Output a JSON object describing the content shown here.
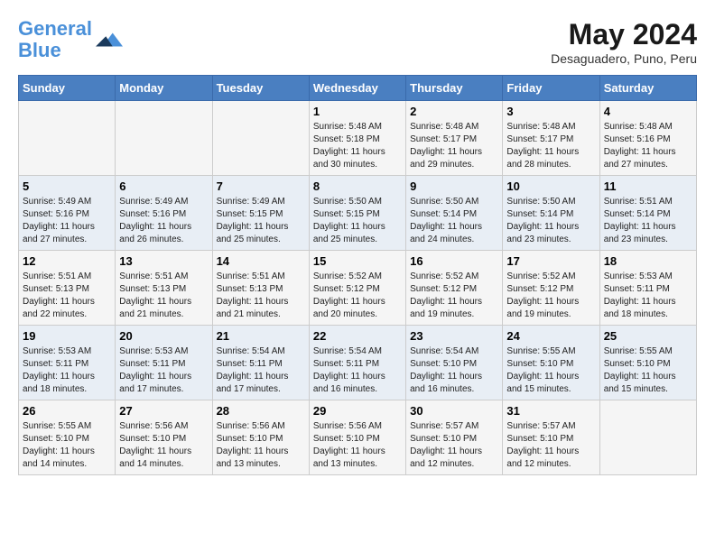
{
  "header": {
    "logo_line1": "General",
    "logo_line2": "Blue",
    "main_title": "May 2024",
    "subtitle": "Desaguadero, Puno, Peru"
  },
  "calendar": {
    "days_of_week": [
      "Sunday",
      "Monday",
      "Tuesday",
      "Wednesday",
      "Thursday",
      "Friday",
      "Saturday"
    ],
    "weeks": [
      [
        {
          "day": "",
          "info": ""
        },
        {
          "day": "",
          "info": ""
        },
        {
          "day": "",
          "info": ""
        },
        {
          "day": "1",
          "info": "Sunrise: 5:48 AM\nSunset: 5:18 PM\nDaylight: 11 hours and 30 minutes."
        },
        {
          "day": "2",
          "info": "Sunrise: 5:48 AM\nSunset: 5:17 PM\nDaylight: 11 hours and 29 minutes."
        },
        {
          "day": "3",
          "info": "Sunrise: 5:48 AM\nSunset: 5:17 PM\nDaylight: 11 hours and 28 minutes."
        },
        {
          "day": "4",
          "info": "Sunrise: 5:48 AM\nSunset: 5:16 PM\nDaylight: 11 hours and 27 minutes."
        }
      ],
      [
        {
          "day": "5",
          "info": "Sunrise: 5:49 AM\nSunset: 5:16 PM\nDaylight: 11 hours and 27 minutes."
        },
        {
          "day": "6",
          "info": "Sunrise: 5:49 AM\nSunset: 5:16 PM\nDaylight: 11 hours and 26 minutes."
        },
        {
          "day": "7",
          "info": "Sunrise: 5:49 AM\nSunset: 5:15 PM\nDaylight: 11 hours and 25 minutes."
        },
        {
          "day": "8",
          "info": "Sunrise: 5:50 AM\nSunset: 5:15 PM\nDaylight: 11 hours and 25 minutes."
        },
        {
          "day": "9",
          "info": "Sunrise: 5:50 AM\nSunset: 5:14 PM\nDaylight: 11 hours and 24 minutes."
        },
        {
          "day": "10",
          "info": "Sunrise: 5:50 AM\nSunset: 5:14 PM\nDaylight: 11 hours and 23 minutes."
        },
        {
          "day": "11",
          "info": "Sunrise: 5:51 AM\nSunset: 5:14 PM\nDaylight: 11 hours and 23 minutes."
        }
      ],
      [
        {
          "day": "12",
          "info": "Sunrise: 5:51 AM\nSunset: 5:13 PM\nDaylight: 11 hours and 22 minutes."
        },
        {
          "day": "13",
          "info": "Sunrise: 5:51 AM\nSunset: 5:13 PM\nDaylight: 11 hours and 21 minutes."
        },
        {
          "day": "14",
          "info": "Sunrise: 5:51 AM\nSunset: 5:13 PM\nDaylight: 11 hours and 21 minutes."
        },
        {
          "day": "15",
          "info": "Sunrise: 5:52 AM\nSunset: 5:12 PM\nDaylight: 11 hours and 20 minutes."
        },
        {
          "day": "16",
          "info": "Sunrise: 5:52 AM\nSunset: 5:12 PM\nDaylight: 11 hours and 19 minutes."
        },
        {
          "day": "17",
          "info": "Sunrise: 5:52 AM\nSunset: 5:12 PM\nDaylight: 11 hours and 19 minutes."
        },
        {
          "day": "18",
          "info": "Sunrise: 5:53 AM\nSunset: 5:11 PM\nDaylight: 11 hours and 18 minutes."
        }
      ],
      [
        {
          "day": "19",
          "info": "Sunrise: 5:53 AM\nSunset: 5:11 PM\nDaylight: 11 hours and 18 minutes."
        },
        {
          "day": "20",
          "info": "Sunrise: 5:53 AM\nSunset: 5:11 PM\nDaylight: 11 hours and 17 minutes."
        },
        {
          "day": "21",
          "info": "Sunrise: 5:54 AM\nSunset: 5:11 PM\nDaylight: 11 hours and 17 minutes."
        },
        {
          "day": "22",
          "info": "Sunrise: 5:54 AM\nSunset: 5:11 PM\nDaylight: 11 hours and 16 minutes."
        },
        {
          "day": "23",
          "info": "Sunrise: 5:54 AM\nSunset: 5:10 PM\nDaylight: 11 hours and 16 minutes."
        },
        {
          "day": "24",
          "info": "Sunrise: 5:55 AM\nSunset: 5:10 PM\nDaylight: 11 hours and 15 minutes."
        },
        {
          "day": "25",
          "info": "Sunrise: 5:55 AM\nSunset: 5:10 PM\nDaylight: 11 hours and 15 minutes."
        }
      ],
      [
        {
          "day": "26",
          "info": "Sunrise: 5:55 AM\nSunset: 5:10 PM\nDaylight: 11 hours and 14 minutes."
        },
        {
          "day": "27",
          "info": "Sunrise: 5:56 AM\nSunset: 5:10 PM\nDaylight: 11 hours and 14 minutes."
        },
        {
          "day": "28",
          "info": "Sunrise: 5:56 AM\nSunset: 5:10 PM\nDaylight: 11 hours and 13 minutes."
        },
        {
          "day": "29",
          "info": "Sunrise: 5:56 AM\nSunset: 5:10 PM\nDaylight: 11 hours and 13 minutes."
        },
        {
          "day": "30",
          "info": "Sunrise: 5:57 AM\nSunset: 5:10 PM\nDaylight: 11 hours and 12 minutes."
        },
        {
          "day": "31",
          "info": "Sunrise: 5:57 AM\nSunset: 5:10 PM\nDaylight: 11 hours and 12 minutes."
        },
        {
          "day": "",
          "info": ""
        }
      ]
    ]
  }
}
